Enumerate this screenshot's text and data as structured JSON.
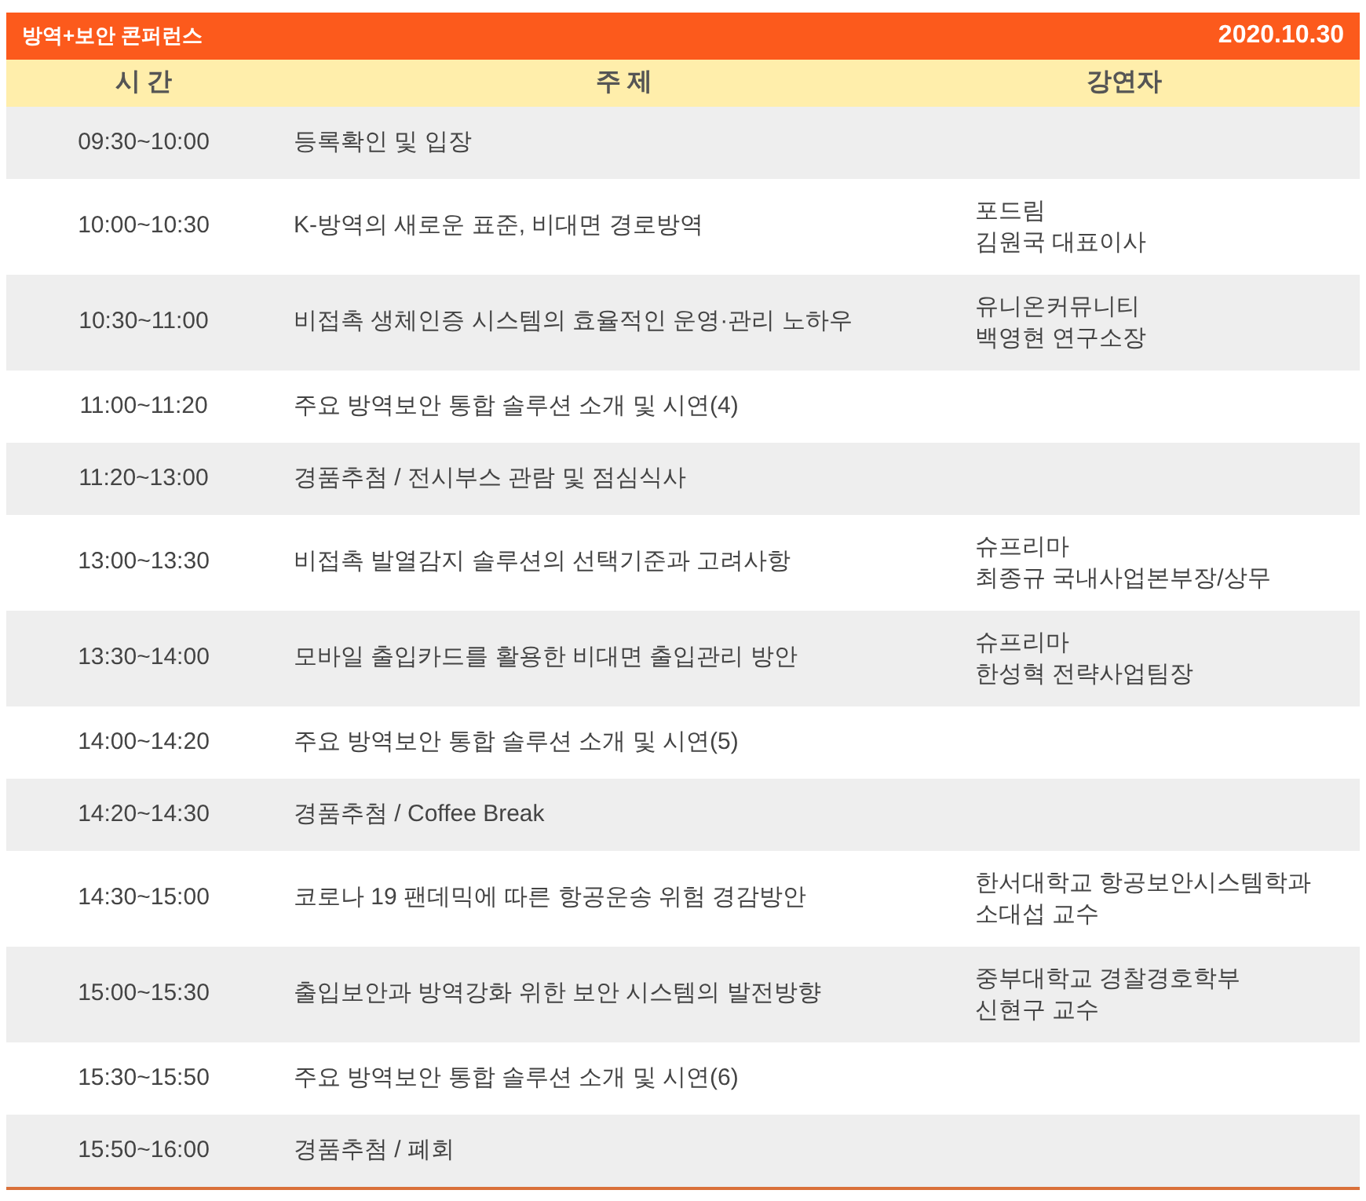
{
  "header": {
    "title": "방역+보안 콘퍼런스",
    "date": "2020.10.30"
  },
  "table": {
    "columns": [
      "시 간",
      "주 제",
      "강연자"
    ],
    "rows": [
      {
        "time": "09:30~10:00",
        "topic": "등록확인 및 입장",
        "speaker": []
      },
      {
        "time": "10:00~10:30",
        "topic": "K-방역의 새로운 표준, 비대면 경로방역",
        "speaker": [
          "포드림",
          "김원국 대표이사"
        ]
      },
      {
        "time": "10:30~11:00",
        "topic": "비접촉 생체인증 시스템의 효율적인 운영·관리 노하우",
        "speaker": [
          "유니온커뮤니티",
          "백영현 연구소장"
        ]
      },
      {
        "time": "11:00~11:20",
        "topic": "주요 방역보안 통합 솔루션 소개 및 시연(4)",
        "speaker": []
      },
      {
        "time": "11:20~13:00",
        "topic": "경품추첨 / 전시부스 관람 및 점심식사",
        "speaker": []
      },
      {
        "time": "13:00~13:30",
        "topic": "비접촉 발열감지 솔루션의 선택기준과 고려사항",
        "speaker": [
          "슈프리마",
          "최종규 국내사업본부장/상무"
        ]
      },
      {
        "time": "13:30~14:00",
        "topic": "모바일 출입카드를 활용한 비대면 출입관리 방안",
        "speaker": [
          "슈프리마",
          "한성혁 전략사업팀장"
        ]
      },
      {
        "time": "14:00~14:20",
        "topic": "주요 방역보안 통합 솔루션 소개 및 시연(5)",
        "speaker": []
      },
      {
        "time": "14:20~14:30",
        "topic": "경품추첨 / Coffee Break",
        "speaker": []
      },
      {
        "time": "14:30~15:00",
        "topic": "코로나 19 팬데믹에 따른 항공운송 위험 경감방안",
        "speaker": [
          "한서대학교 항공보안시스템학과",
          "소대섭 교수"
        ]
      },
      {
        "time": "15:00~15:30",
        "topic": "출입보안과 방역강화 위한 보안 시스템의 발전방향",
        "speaker": [
          "중부대학교 경찰경호학부",
          "신현구 교수"
        ]
      },
      {
        "time": "15:30~15:50",
        "topic": "주요 방역보안 통합 솔루션 소개 및 시연(6)",
        "speaker": []
      },
      {
        "time": "15:50~16:00",
        "topic": "경품추첨 / 폐회",
        "speaker": []
      }
    ]
  }
}
